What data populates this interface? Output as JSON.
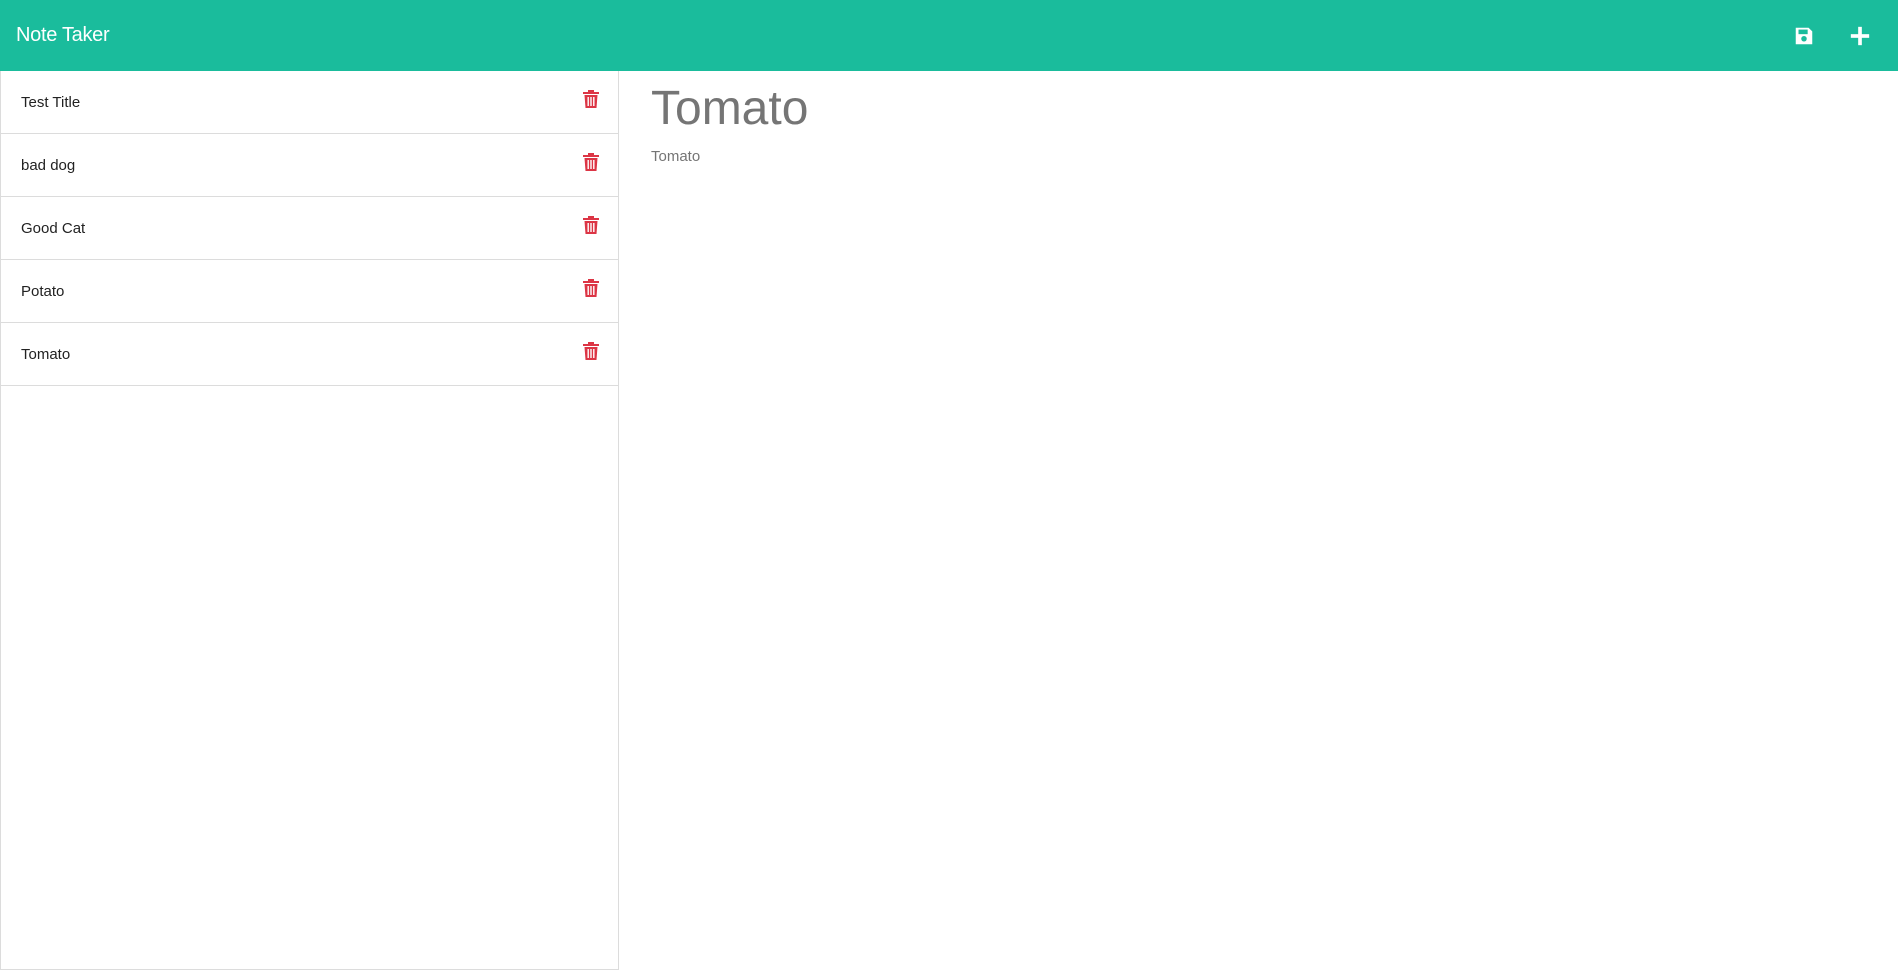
{
  "navbar": {
    "brand": "Note Taker",
    "icons": {
      "save": "save-icon",
      "new": "plus-icon"
    },
    "background": "#1abc9c"
  },
  "sidebar": {
    "notes": [
      {
        "title": "Test Title",
        "icon": "trash-icon"
      },
      {
        "title": "bad dog",
        "icon": "trash-icon"
      },
      {
        "title": "Good Cat",
        "icon": "trash-icon"
      },
      {
        "title": "Potato",
        "icon": "trash-icon"
      },
      {
        "title": "Tomato",
        "icon": "trash-icon"
      }
    ],
    "delete_color": "#dc3545"
  },
  "editor": {
    "title": "Tomato",
    "body": "Tomato"
  }
}
